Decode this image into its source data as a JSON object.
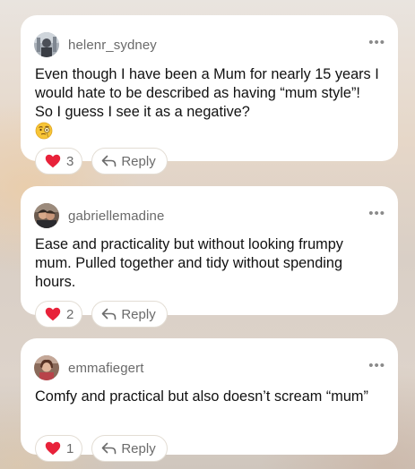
{
  "comments": [
    {
      "username": "helenr_sydney",
      "text": "Even though I have been a Mum for nearly 15 years I would hate to be described as having “mum style”! So I guess I see it as a negative?",
      "emoji": "monocle-face",
      "likes": "3",
      "reply_label": "Reply",
      "more_label": "•••"
    },
    {
      "username": "gabriellemadine",
      "text": "Ease and practicality but without looking frumpy mum. Pulled together and tidy without spending hours.",
      "likes": "2",
      "reply_label": "Reply",
      "more_label": "•••"
    },
    {
      "username": "emmafiegert",
      "text": "Comfy and practical but also doesn’t scream “mum”",
      "likes": "1",
      "reply_label": "Reply",
      "more_label": "•••"
    }
  ],
  "colors": {
    "heart": "#e8223a",
    "username": "#6a6a6a",
    "body_text": "#111111",
    "pill_border": "#e3ddd4"
  },
  "icons": {
    "like": "heart-icon",
    "reply": "reply-arrow-icon",
    "more": "more-dots-icon"
  }
}
